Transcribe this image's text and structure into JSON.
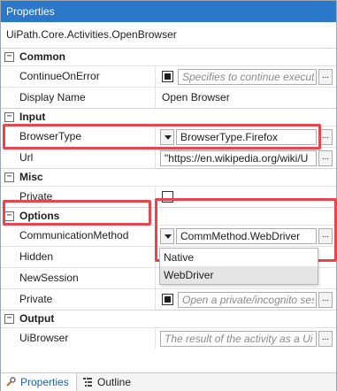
{
  "panel": {
    "title": "Properties",
    "type_name": "UiPath.Core.Activities.OpenBrowser"
  },
  "categories": {
    "common": {
      "label": "Common",
      "toggle": "−"
    },
    "input": {
      "label": "Input",
      "toggle": "−"
    },
    "misc": {
      "label": "Misc",
      "toggle": "−"
    },
    "options": {
      "label": "Options",
      "toggle": "−"
    },
    "output": {
      "label": "Output",
      "toggle": "−"
    }
  },
  "properties": {
    "continue_on_error": {
      "name": "ContinueOnError",
      "placeholder": "Specifies to continue executi",
      "checked": true
    },
    "display_name": {
      "name": "Display Name",
      "value": "Open Browser"
    },
    "browser_type": {
      "name": "BrowserType",
      "value": "BrowserType.Firefox"
    },
    "url": {
      "name": "Url",
      "value": "\"https://en.wikipedia.org/wiki/U"
    },
    "private_misc": {
      "name": "Private",
      "checked": false
    },
    "communication_method": {
      "name": "CommunicationMethod",
      "value": "CommMethod.WebDriver"
    },
    "hidden": {
      "name": "Hidden"
    },
    "new_session": {
      "name": "NewSession"
    },
    "private_options": {
      "name": "Private",
      "placeholder": "Open a private/incognito ses",
      "checked": true
    },
    "ui_browser": {
      "name": "UiBrowser",
      "placeholder": "The result of the activity as a Ui"
    }
  },
  "ellipsis_label": "...",
  "dropdown": {
    "options": [
      "Native",
      "WebDriver"
    ],
    "selected": "WebDriver"
  },
  "tabs": [
    {
      "label": "Properties",
      "active": true
    },
    {
      "label": "Outline",
      "active": false
    }
  ],
  "colors": {
    "title_bar": "#2b77c9",
    "highlight": "#e8454c",
    "active_tab_text": "#1f5fab"
  }
}
